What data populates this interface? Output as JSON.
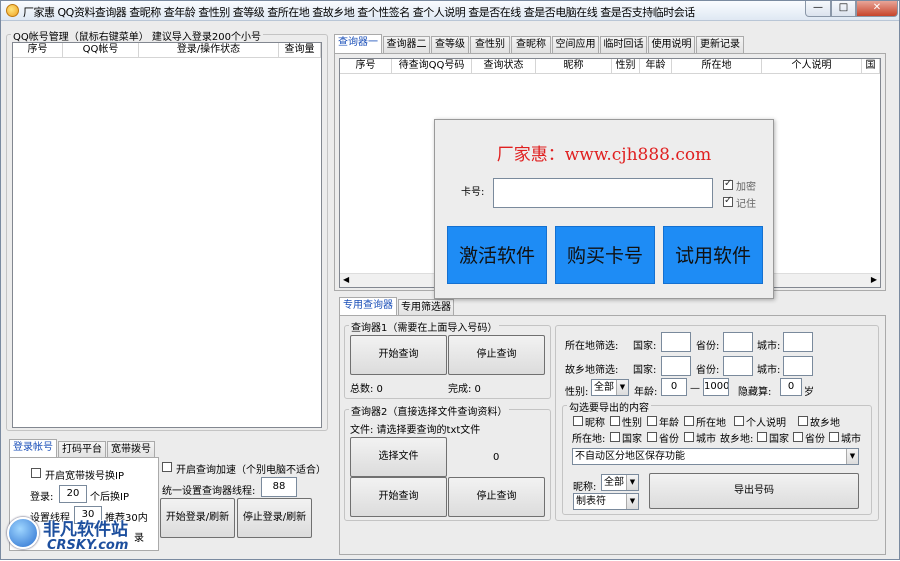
{
  "window": {
    "title": "厂家惠 QQ资料查询器 查昵称 查年龄 查性别 查等级 查所在地 查故乡地 查个性签名 查个人说明 查是否在线 查是否电脑在线 查是否支持临时会话",
    "min": "—",
    "max": "□",
    "close": "✕"
  },
  "left": {
    "group_label": "QQ帐号管理（鼠标右键菜单）    建议导入登录200个小号",
    "columns": [
      "序号",
      "QQ帐号",
      "登录/操作状态",
      "查询量"
    ],
    "tabs": [
      "登录帐号",
      "打码平台",
      "宽带拨号"
    ],
    "broadband_check": "开启宽带拨号换IP",
    "login_label": "登录:",
    "login_value": "20",
    "login_suffix": "个后换IP",
    "setting_label": "设置线程",
    "setting_value": "30",
    "setting_suffix": "推荐30内",
    "speedup_check": "开启查询加速（个别电脑不适合）",
    "threads_label": "统一设置查询器线程:",
    "threads_value": "88",
    "btn_start_login": "开始登录/刷新",
    "btn_stop_login": "停止登录/刷新",
    "partial_text": "录"
  },
  "right": {
    "tabs": [
      "查询器一",
      "查询器二",
      "查等级",
      "查性别",
      "查昵称",
      "空间应用",
      "临时回话",
      "使用说明",
      "更新记录"
    ],
    "columns": [
      "序号",
      "待查询QQ号码",
      "查询状态",
      "昵称",
      "性别",
      "年龄",
      "所在地",
      "个人说明",
      "国"
    ],
    "sub_tabs": [
      "专用查询器",
      "专用筛选器"
    ],
    "q1_label": "查询器1（需要在上面导入号码）",
    "q1_start": "开始查询",
    "q1_stop": "停止查询",
    "total_label": "总数: 0",
    "done_label": "完成: 0",
    "q2_label": "查询器2（直接选择文件查询资料）",
    "file_label": "文件: 请选择要查询的txt文件",
    "select_file": "选择文件",
    "file_count": "0",
    "q2_start": "开始查询",
    "q2_stop": "停止查询"
  },
  "filter": {
    "loc_label": "所在地筛选:",
    "home_label": "故乡地筛选:",
    "country": "国家:",
    "province": "省份:",
    "city": "城市:",
    "gender_label": "性别:",
    "gender_value": "全部",
    "age_label": "年龄:",
    "age_min": "0",
    "age_dash": "—",
    "age_max": "1000",
    "hidden_label": "隐藏算:",
    "hidden_value": "0",
    "hidden_suffix": "岁",
    "export_group": "勾选要导出的内容",
    "opts_row1": [
      "昵称",
      "性别",
      "年龄",
      "所在地",
      "个人说明",
      "故乡地"
    ],
    "loc_prefix": "所在地:",
    "opts_row2a": [
      "国家",
      "省份",
      "城市"
    ],
    "home_prefix": "故乡地:",
    "opts_row2b": [
      "国家",
      "省份",
      "城市"
    ],
    "region_select": "不自动区分地区保存功能",
    "nick_label": "昵称:",
    "nick_value": "全部",
    "tab_value": "制表符",
    "export_btn": "导出号码"
  },
  "popup": {
    "headline": "厂家惠：www.cjh888.com",
    "card_label": "卡号:",
    "card_value": "",
    "encrypt_label": "加密",
    "remember_label": "记住",
    "btn_activate": "激活软件",
    "btn_buy": "购买卡号",
    "btn_trial": "试用软件"
  },
  "watermark": {
    "cn": "非凡软件站",
    "en": "CRSKY.com"
  },
  "colors": {
    "accent_blue": "#1e8cf5",
    "headline_red": "#e02020",
    "tab_blue": "#1a4fb8"
  }
}
